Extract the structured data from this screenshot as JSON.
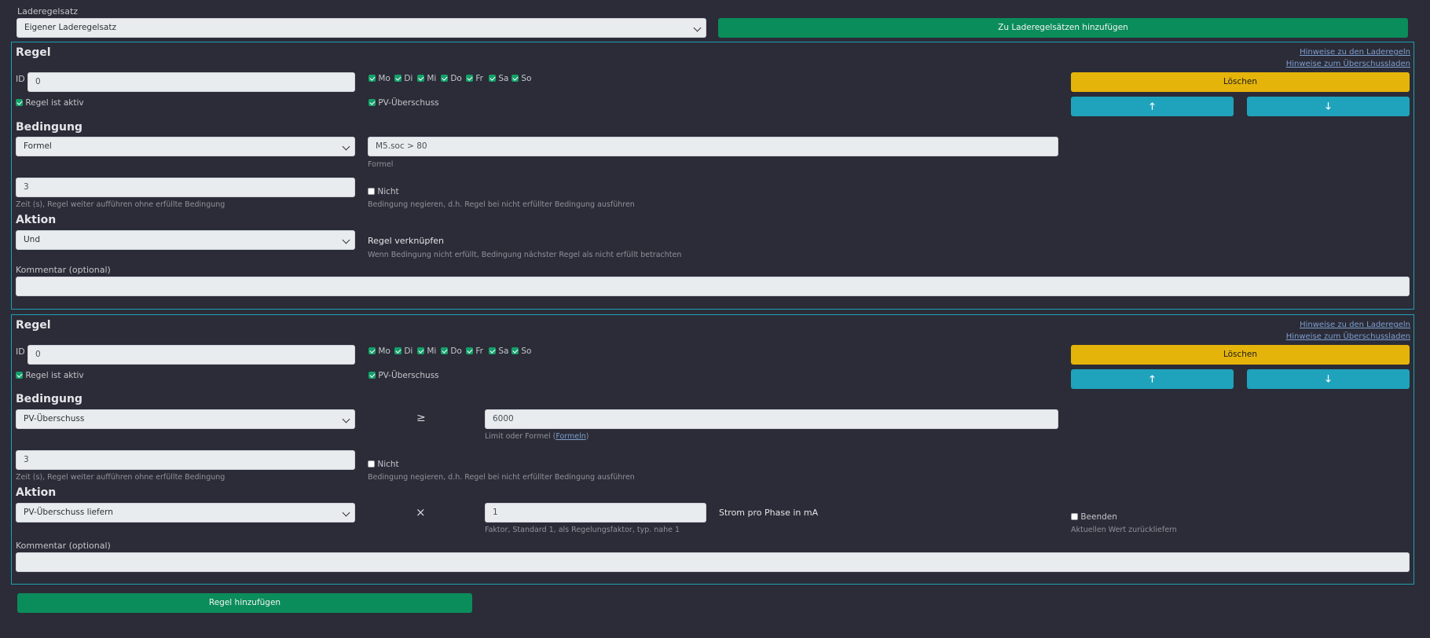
{
  "header": {
    "label": "Laderegelsatz",
    "select_value": "Eigener Laderegelsatz",
    "add_button": "Zu Laderegelsätzen hinzufügen"
  },
  "common": {
    "rule_title": "Regel",
    "link_rules": "Hinweise zu den Laderegeln",
    "link_surplus": "Hinweise zum Überschussladen",
    "id_label": "ID",
    "delete_button": "Löschen",
    "up_icon": "arrow-up-icon",
    "down_icon": "arrow-down-icon",
    "active_label": "Regel ist aktiv",
    "pv_label": "PV-Überschuss",
    "days": [
      "Mo",
      "Di",
      "Mi",
      "Do",
      "Fr",
      "Sa",
      "So"
    ],
    "condition_title": "Bedingung",
    "time_help": "Zeit (s), Regel weiter aufführen ohne erfüllte Bedingung",
    "not_label": "Nicht",
    "not_help": "Bedingung negieren, d.h. Regel bei nicht erfüllter Bedingung ausführen",
    "action_title": "Aktion",
    "comment_label": "Kommentar (optional)"
  },
  "rule1": {
    "id_value": "0",
    "condition_type": "Formel",
    "formula_value": "M5.soc > 80",
    "formula_label": "Formel",
    "time_value": "3",
    "action_value": "Und",
    "link_title": "Regel verknüpfen",
    "link_help": "Wenn Bedingung nicht erfüllt, Bedingung nächster Regel als nicht erfüllt betrachten",
    "comment_value": ""
  },
  "rule2": {
    "id_value": "0",
    "condition_type": "PV-Überschuss",
    "operator": "≥",
    "limit_value": "6000",
    "limit_help_prefix": "Limit oder Formel (",
    "limit_help_link": "Formeln",
    "limit_help_suffix": ")",
    "time_value": "3",
    "action_value": "PV-Überschuss liefern",
    "multiply": "×",
    "factor_value": "1",
    "factor_help": "Faktor, Standard 1, als Regelungsfaktor, typ. nahe 1",
    "current_label": "Strom pro Phase in mA",
    "end_label": "Beenden",
    "end_help": "Aktuellen Wert zurückliefern",
    "comment_value": ""
  },
  "footer": {
    "add_rule_button": "Regel hinzufügen"
  },
  "colors": {
    "background": "#2b2c37",
    "accent_green": "#0b8c5b",
    "delete_yellow": "#e5b40a",
    "move_blue": "#1fa3bc",
    "border_cyan": "#1f9fb6"
  }
}
